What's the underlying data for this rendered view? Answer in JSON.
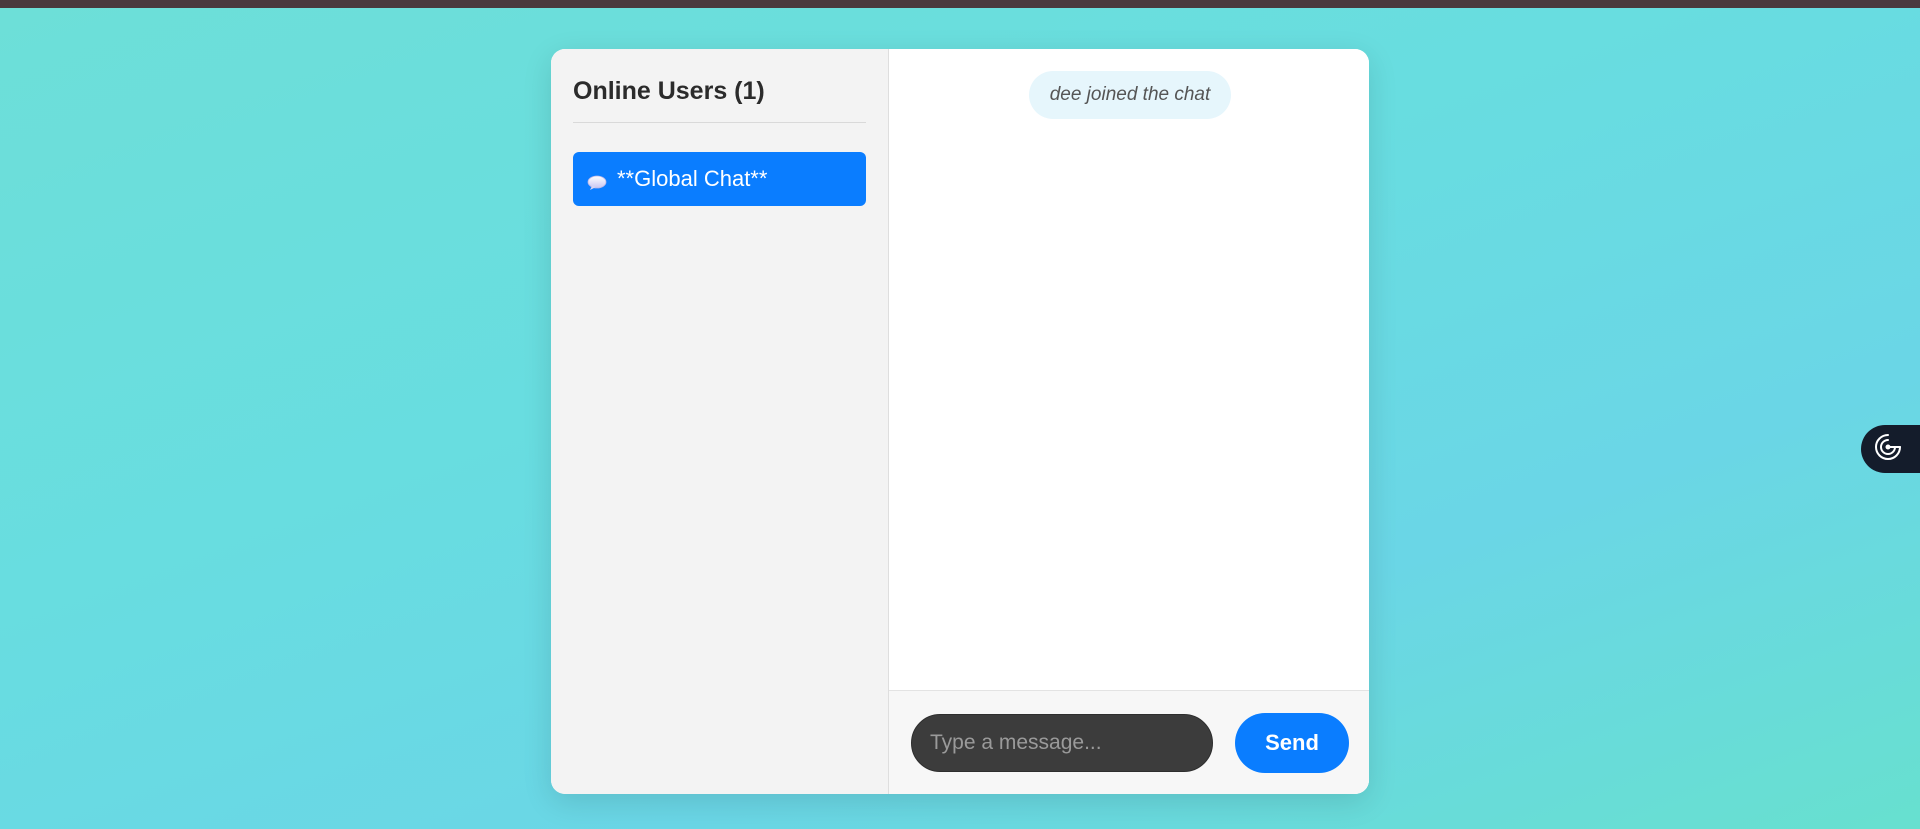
{
  "sidebar": {
    "title": "Online Users (1)",
    "items": [
      {
        "label": "**Global Chat**",
        "icon": "speech-bubble-icon",
        "active": true
      }
    ]
  },
  "chat": {
    "messages": [
      {
        "type": "system",
        "text": "dee joined the chat"
      }
    ]
  },
  "composer": {
    "placeholder": "Type a message...",
    "value": "",
    "send_label": "Send"
  },
  "widget": {
    "icon": "target-swirl-icon"
  },
  "colors": {
    "accent": "#0a7dff",
    "sidebar_bg": "#f3f3f3",
    "system_bubble": "#e6f6fc",
    "input_bg": "#3c3c3c",
    "page_bg": "#68dde0",
    "top_bar": "#4a3a3e",
    "widget_bg": "#141c2b"
  }
}
